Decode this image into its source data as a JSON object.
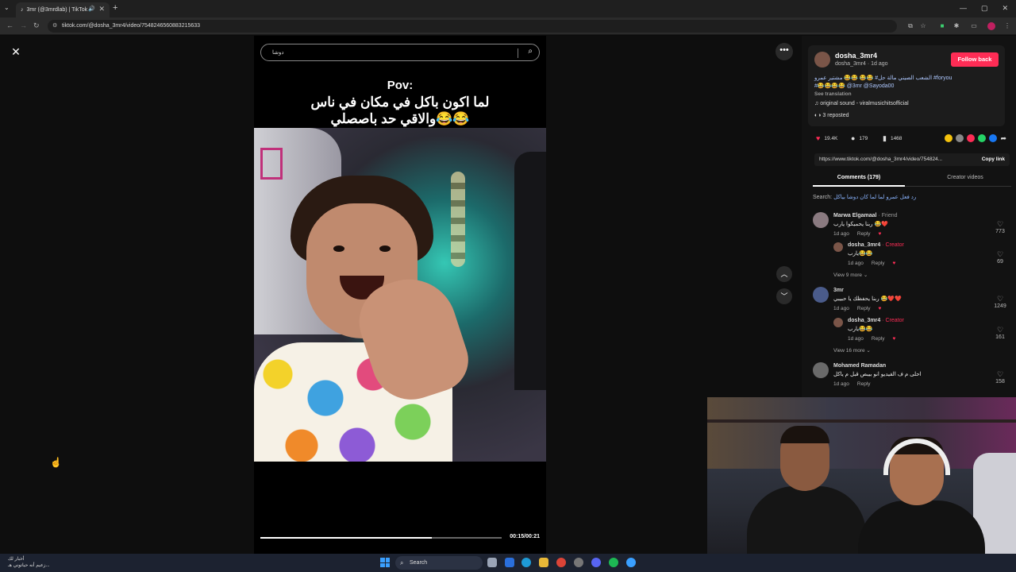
{
  "browser": {
    "tab_title": "3mr (@3mrdlab) | TikTok",
    "url": "tiktok.com/@dosha_3mr4/video/7548246560883215633",
    "window_controls": [
      "—",
      "▢",
      "✕"
    ]
  },
  "video": {
    "search_query": "دوشا",
    "caption_title": "Pov:",
    "caption_line1": "لما اكون باكل في مكان في ناس",
    "caption_line2": "والاقي حد باصصلي😂😂",
    "time": "00:15/00:21",
    "progress": 0.71
  },
  "post": {
    "username": "dosha_3mr4",
    "subtitle": "dosha_3mr4 · 1d ago",
    "follow_label": "Follow back",
    "desc_line1": "الشعب الصيني مالة حل# 😂😂 😂😂 مشتير عمرو #foryou",
    "desc_line2": "#😂😂😂😂 @3mr @Sayoda00",
    "see_translation": "See translation",
    "sound": "original sound - viralmusichitsofficial",
    "reposted": "3 reposted",
    "likes": "19.4K",
    "comments_count": "179",
    "saves": "1468",
    "link": "https://www.tiktok.com/@dosha_3mr4/video/754824...",
    "copy_link": "Copy link",
    "share_colors": [
      "#f4c20d",
      "#888888",
      "#fe2c55",
      "#25d366",
      "#1877f2"
    ]
  },
  "tabs": {
    "comments": "Comments (179)",
    "creator_videos": "Creator videos"
  },
  "search_hint": {
    "label": "Search:",
    "query": "رد فعل عمرو لما لما كان دوشا بياكل"
  },
  "comments": [
    {
      "name": "Marwa Elgamaal",
      "tag": " · Friend",
      "text": "ربنا يحميكوا يارب 😂❤️",
      "time": "1d ago",
      "reply": "Reply",
      "likes": "773"
    },
    {
      "name": "dosha_3mr4",
      "tag": " · Creator",
      "text": "يارب😂😂",
      "time": "1d ago",
      "reply": "Reply",
      "likes": "69",
      "view_more": "View 9 more ⌄"
    },
    {
      "name": "3mr",
      "tag": "",
      "text": "ربنا يحفظك يا حبيبي 😂❤️❤️",
      "time": "1d ago",
      "reply": "Reply",
      "likes": "1249"
    },
    {
      "name": "dosha_3mr4",
      "tag": " · Creator",
      "text": "يارب😂😂",
      "time": "1d ago",
      "reply": "Reply",
      "likes": "161",
      "view_more": "View 16 more ⌄"
    },
    {
      "name": "Mohamed Ramadan",
      "tag": "",
      "text": "احلى م ف الفيديو انو بيبص قبل م ياكل",
      "time": "1d ago",
      "reply": "Reply",
      "likes": "158"
    }
  ],
  "taskbar": {
    "weather_line1": "أخبار لك",
    "weather_line2": "زعيم أنه حياتوني هـ...",
    "search": "Search"
  }
}
